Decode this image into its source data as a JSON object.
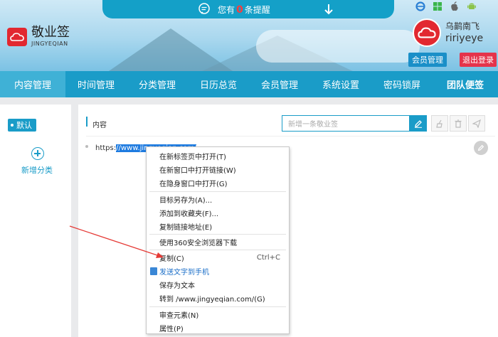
{
  "notice": {
    "prefix": "您有",
    "count": "0",
    "suffix": "条提醒"
  },
  "app": {
    "name": "敬业签",
    "subname": "JINGYEQIAN"
  },
  "platform_icons": [
    "ie-icon",
    "windows-icon",
    "apple-icon",
    "android-icon"
  ],
  "user": {
    "nickname": "乌鹋南飞",
    "username": "ririyeye"
  },
  "header_buttons": {
    "member": "会员管理",
    "logout": "退出登录"
  },
  "nav": [
    {
      "label": "内容管理",
      "active": true
    },
    {
      "label": "时间管理"
    },
    {
      "label": "分类管理"
    },
    {
      "label": "日历总览"
    },
    {
      "label": "会员管理"
    },
    {
      "label": "系统设置"
    },
    {
      "label": "密码锁屏"
    },
    {
      "label": "团队便签",
      "bold": true
    }
  ],
  "sidebar": {
    "default": "默认",
    "add_category": "新增分类"
  },
  "content": {
    "title": "内容",
    "search_placeholder": "新增一条敬业签",
    "url_prefix": "https:",
    "url_selected": "//www.jingyeqian.com/"
  },
  "context_menu": {
    "items": [
      "在新标签页中打开(T)",
      "在新窗口中打开链接(W)",
      "在隐身窗口中打开(G)",
      "目标另存为(A)...",
      "添加到收藏夹(F)...",
      "复制链接地址(E)",
      "使用360安全浏览器下载",
      "复制(C)",
      "发送文字到手机",
      "保存为文本",
      "转到 /www.jingyeqian.com/(G)",
      "审查元素(N)",
      "属性(P)"
    ],
    "copy_shortcut": "Ctrl+C"
  },
  "colors": {
    "primary": "#1a9cc8",
    "logout": "#e5334b",
    "brand_red": "#e22830",
    "selection": "#1e7be0"
  }
}
